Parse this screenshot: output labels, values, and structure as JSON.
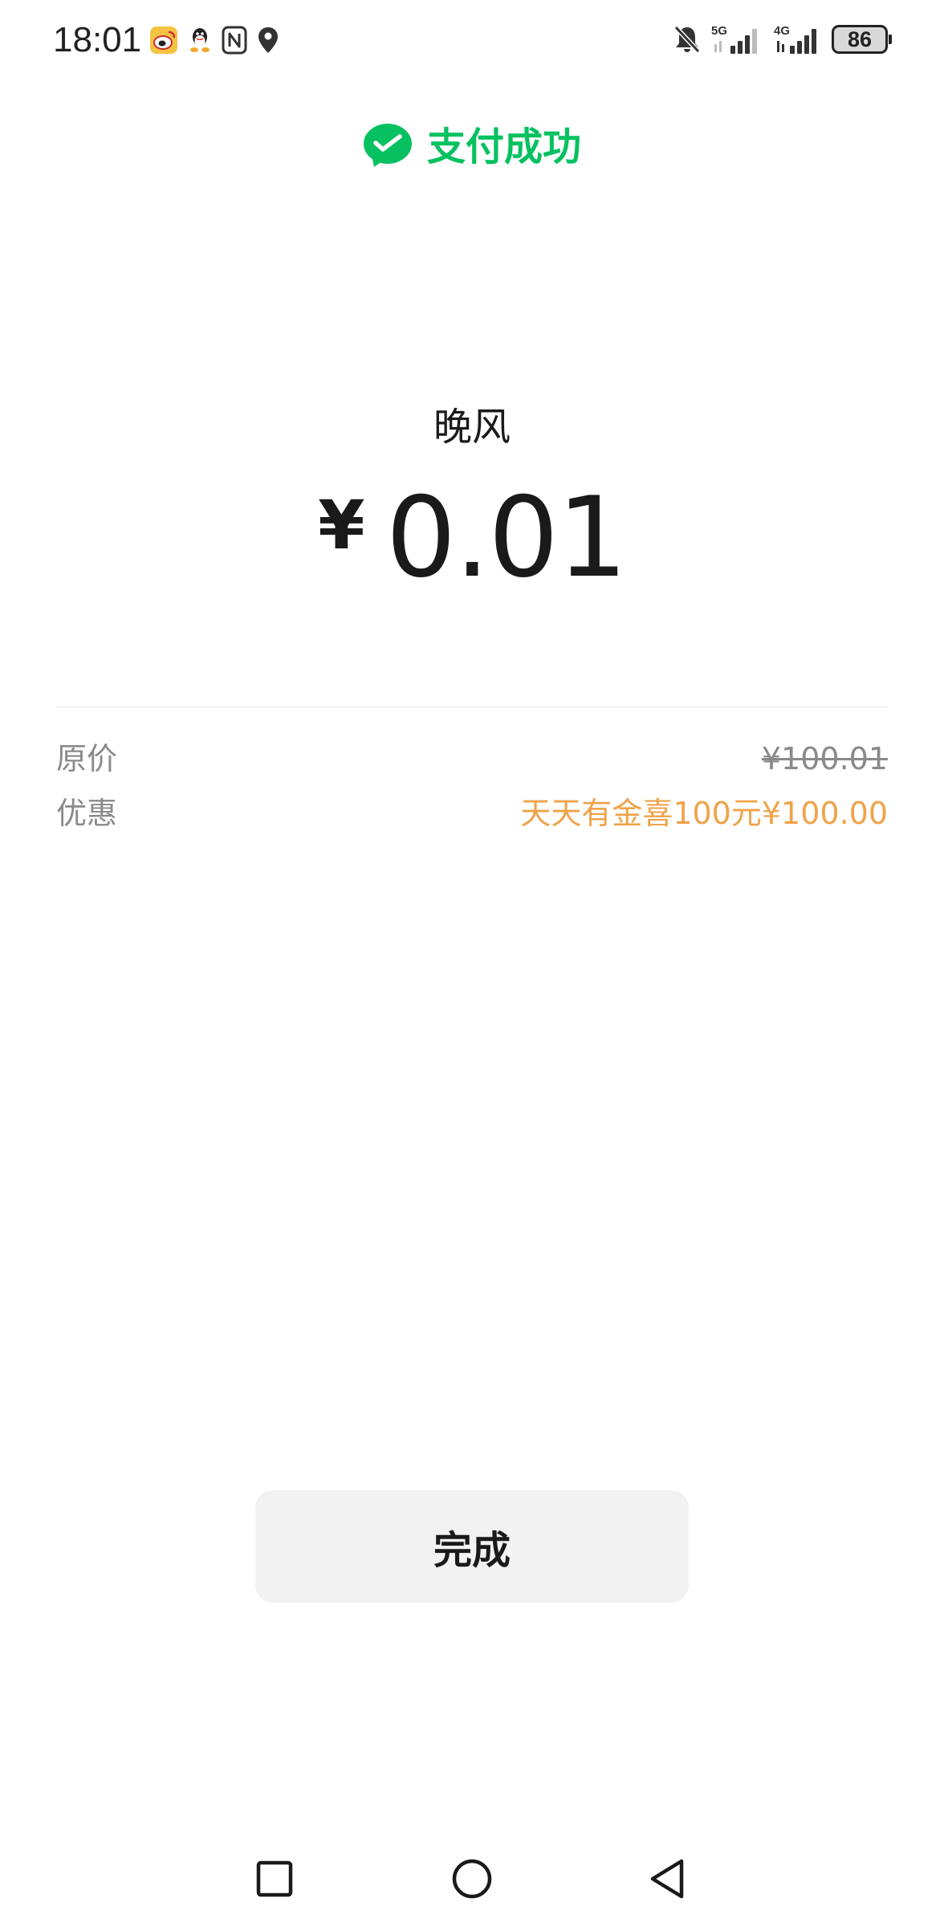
{
  "status_bar": {
    "time": "18:01",
    "battery_level": "86",
    "network_5g": "5G",
    "network_4g": "4G",
    "icons_left": [
      "weibo-icon",
      "qq-icon",
      "nfc-icon",
      "location-icon"
    ],
    "icons_right": [
      "bell-muted-icon",
      "signal-5g-icon",
      "signal-4g-icon",
      "battery-icon"
    ]
  },
  "header": {
    "title": "支付成功",
    "icon": "wechat-pay-check-icon"
  },
  "payment": {
    "merchant": "晚风",
    "currency_symbol": "¥",
    "amount": "0.01"
  },
  "details": {
    "original_label": "原价",
    "original_value": "¥100.01",
    "discount_label": "优惠",
    "discount_value": "天天有金喜100元¥100.00"
  },
  "actions": {
    "done_label": "完成"
  },
  "nav": {
    "items": [
      "recents-icon",
      "home-icon",
      "back-icon"
    ]
  },
  "colors": {
    "accent_green": "#07c160",
    "discount_orange": "#f0a34a",
    "muted_text": "#8a8a8a",
    "button_bg": "#f2f2f2"
  }
}
